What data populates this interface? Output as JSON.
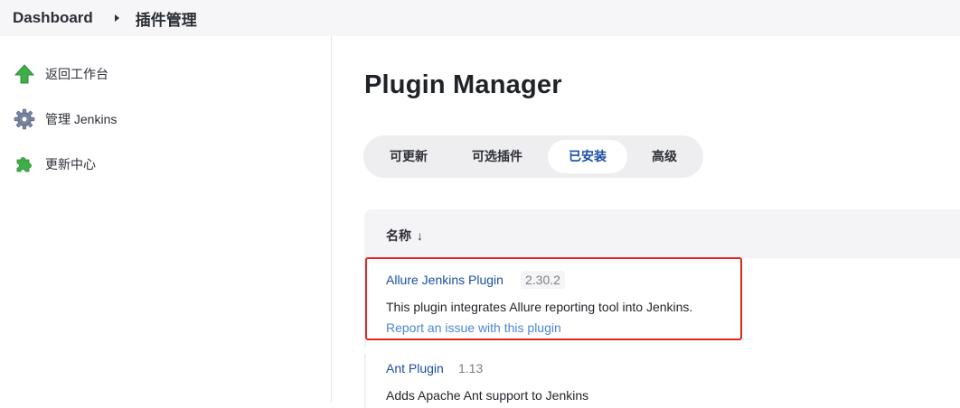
{
  "breadcrumb": {
    "home": "Dashboard",
    "current": "插件管理"
  },
  "sidebar": {
    "items": [
      {
        "label": "返回工作台",
        "icon": "up-arrow-icon"
      },
      {
        "label": "管理 Jenkins",
        "icon": "gear-icon"
      },
      {
        "label": "更新中心",
        "icon": "puzzle-icon"
      }
    ]
  },
  "main": {
    "title": "Plugin Manager",
    "tabs": [
      {
        "label": "可更新"
      },
      {
        "label": "可选插件"
      },
      {
        "label": "已安装",
        "active": true
      },
      {
        "label": "高级"
      }
    ],
    "table": {
      "column_name": "名称",
      "sort_indicator": "↓"
    },
    "plugins": [
      {
        "name": "Allure Jenkins Plugin",
        "version": "2.30.2",
        "description": "This plugin integrates Allure reporting tool into Jenkins.",
        "report_link": "Report an issue with this plugin"
      },
      {
        "name": "Ant Plugin",
        "version": "1.13",
        "description": "Adds Apache Ant support to Jenkins"
      }
    ]
  },
  "colors": {
    "link": "#1b4ea3",
    "report_link": "#4a86d6",
    "highlight_border": "#e0261f",
    "green_icon": "#3fae49"
  }
}
